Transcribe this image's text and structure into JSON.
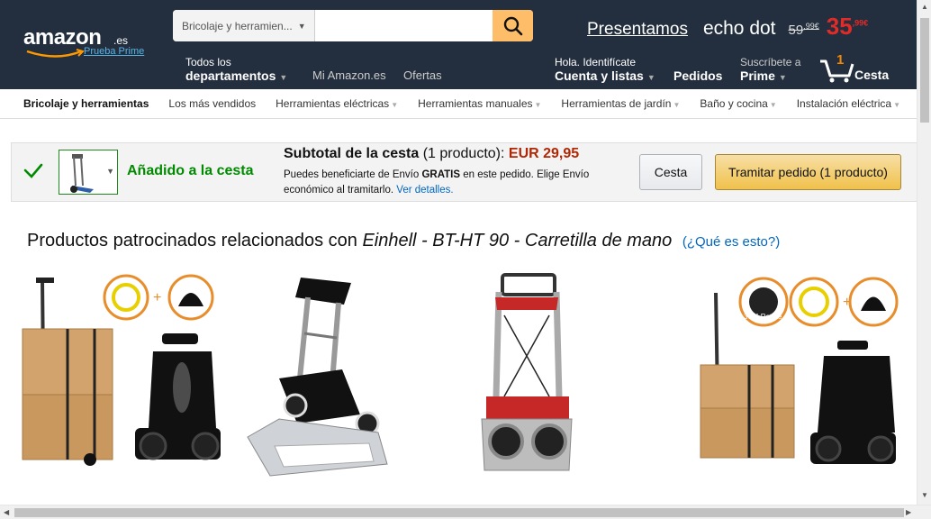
{
  "header": {
    "logo_text": "amazon",
    "logo_suffix": ".es",
    "prime_trial": "Prueba Prime",
    "search_category": "Bricolaje y herramien...",
    "search_value": "",
    "promo_link": "Presentamos",
    "promo_product": "echo dot",
    "promo_old_price": "59",
    "promo_old_cents": ",99€",
    "promo_new_price": "35",
    "promo_new_cents": ",99€",
    "departments_small": "Todos los",
    "departments_big": "departamentos",
    "my_amazon": "Mi Amazon.es",
    "offers": "Ofertas",
    "account_small": "Hola. Identifícate",
    "account_big": "Cuenta y listas",
    "orders": "Pedidos",
    "prime_small": "Suscríbete a",
    "prime_big": "Prime",
    "cart_count": "1",
    "cart_label": "Cesta"
  },
  "subnav": {
    "items": [
      {
        "label": "Bricolaje y herramientas"
      },
      {
        "label": "Los más vendidos"
      },
      {
        "label": "Herramientas eléctricas"
      },
      {
        "label": "Herramientas manuales"
      },
      {
        "label": "Herramientas de jardín"
      },
      {
        "label": "Baño y cocina"
      },
      {
        "label": "Instalación eléctrica"
      }
    ]
  },
  "added": {
    "title": "Añadido a la cesta",
    "subtotal_label": "Subtotal de la cesta",
    "subtotal_count": "(1 producto):",
    "subtotal_price": "EUR 29,95",
    "note_part1": "Puedes beneficiarte de Envío ",
    "note_bold": "GRATIS",
    "note_part2": " en este pedido. Elige Envío económico al tramitarlo. ",
    "note_link": "Ver detalles.",
    "cart_button": "Cesta",
    "checkout_button": "Tramitar pedido (1 producto)"
  },
  "sponsored": {
    "prefix": "Productos patrocinados relacionados con ",
    "product": "Einhell - BT-HT 90 - Carretilla de mano",
    "what": "(¿Qué es esto?)"
  },
  "colors": {
    "header_bg": "#232f3e",
    "accent": "#febd69",
    "success": "#008a00",
    "price": "#b12704",
    "link": "#0066c0"
  }
}
